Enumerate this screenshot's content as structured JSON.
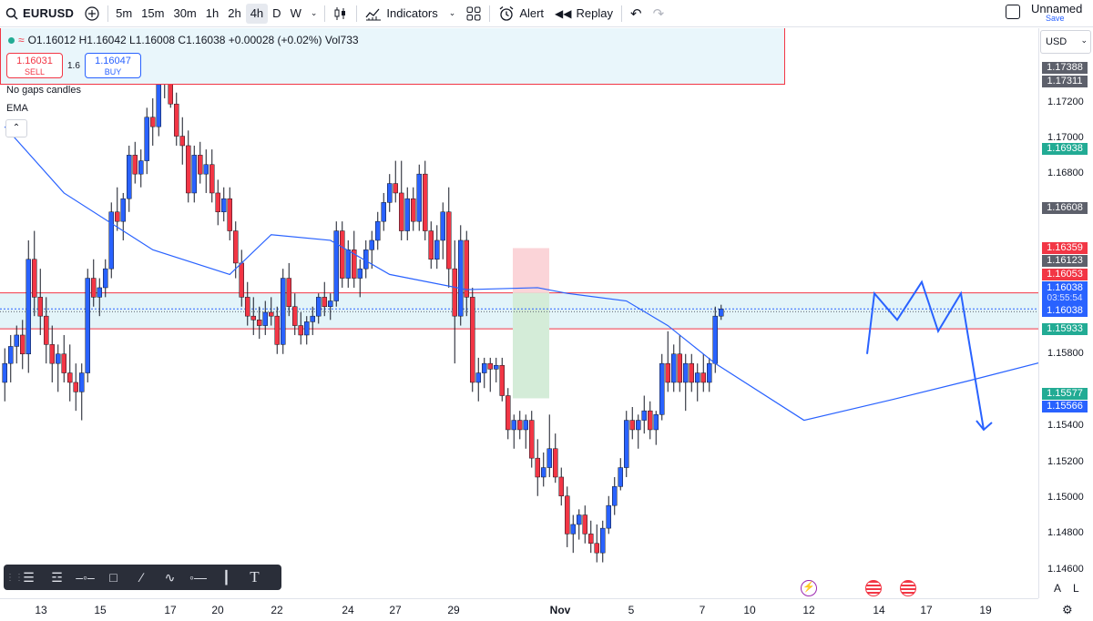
{
  "toolbar": {
    "symbol": "EURUSD",
    "timeframes": [
      "5m",
      "15m",
      "30m",
      "1h",
      "2h",
      "4h",
      "D",
      "W"
    ],
    "active_timeframe": "4h",
    "indicators_label": "Indicators",
    "alert_label": "Alert",
    "replay_label": "Replay",
    "layout_name": "Unnamed",
    "save_label": "Save"
  },
  "legend": {
    "ohlc": "O1.16012 H1.16042 L1.16008 C1.16038 +0.00028 (+0.02%) Vol733",
    "sell_price": "1.16031",
    "sell_label": "SELL",
    "spread": "1.6",
    "buy_price": "1.16047",
    "buy_label": "BUY",
    "indicator_1": "No gaps candles",
    "indicator_2": "EMA",
    "collapse_icon": "chevron-up-icon"
  },
  "price_axis": {
    "currency": "USD",
    "ticks": [
      "1.17200",
      "1.17000",
      "1.16800",
      "1.15800",
      "1.15400",
      "1.15200",
      "1.15000",
      "1.14800",
      "1.14600"
    ],
    "tags": [
      {
        "text": "1.17388",
        "color": "#5d606b"
      },
      {
        "text": "1.17311",
        "color": "#5d606b"
      },
      {
        "text": "1.16938",
        "color": "#22ab94"
      },
      {
        "text": "1.16608",
        "color": "#5d606b"
      },
      {
        "text": "1.16359",
        "color": "#f23645"
      },
      {
        "text": "1.16123",
        "color": "#5d606b"
      },
      {
        "text": "1.16053",
        "color": "#f23645"
      },
      {
        "text": "1.16038",
        "color": "#2962ff"
      },
      {
        "text": "03:55:54",
        "color": "#2962ff"
      },
      {
        "text": "1.16038",
        "color": "#2962ff"
      },
      {
        "text": "1.15933",
        "color": "#22ab94"
      },
      {
        "text": "1.15577",
        "color": "#22ab94"
      },
      {
        "text": "1.15566",
        "color": "#2962ff"
      }
    ]
  },
  "time_axis": {
    "ticks": [
      "13",
      "15",
      "17",
      "20",
      "22",
      "24",
      "27",
      "29",
      "Nov",
      "5",
      "7",
      "10",
      "12",
      "14",
      "17",
      "19"
    ]
  },
  "bottom_right": {
    "auto_label": "A",
    "log_label": "L"
  },
  "colors": {
    "up": "#2962ff",
    "down": "#f23645",
    "ema": "#2962ff",
    "zone": "#e3f4f9",
    "stop": "#fbd4d8",
    "target": "#d4ecd8"
  },
  "chart_data": {
    "type": "candlestick",
    "instrument": "EURUSD",
    "interval": "4h",
    "ylim": [
      1.1452,
      1.1752
    ],
    "zone": [
      1.15933,
      1.16123
    ],
    "candles": [
      [
        1.1565,
        1.1583,
        1.1555,
        1.1575
      ],
      [
        1.1575,
        1.159,
        1.1565,
        1.1584
      ],
      [
        1.1584,
        1.1595,
        1.1575,
        1.159
      ],
      [
        1.159,
        1.1598,
        1.1572,
        1.158
      ],
      [
        1.158,
        1.164,
        1.157,
        1.163
      ],
      [
        1.163,
        1.1645,
        1.16,
        1.161
      ],
      [
        1.161,
        1.1625,
        1.159,
        1.16
      ],
      [
        1.16,
        1.161,
        1.1575,
        1.1585
      ],
      [
        1.1585,
        1.1595,
        1.1565,
        1.1575
      ],
      [
        1.1575,
        1.1585,
        1.156,
        1.158
      ],
      [
        1.158,
        1.159,
        1.1565,
        1.157
      ],
      [
        1.157,
        1.1585,
        1.1555,
        1.1565
      ],
      [
        1.1565,
        1.1575,
        1.155,
        1.156
      ],
      [
        1.156,
        1.1575,
        1.1545,
        1.157
      ],
      [
        1.157,
        1.1625,
        1.1565,
        1.162
      ],
      [
        1.162,
        1.163,
        1.1605,
        1.161
      ],
      [
        1.161,
        1.162,
        1.16,
        1.1615
      ],
      [
        1.1615,
        1.163,
        1.161,
        1.1625
      ],
      [
        1.1625,
        1.166,
        1.162,
        1.1655
      ],
      [
        1.1655,
        1.1668,
        1.1645,
        1.165
      ],
      [
        1.165,
        1.1665,
        1.164,
        1.1662
      ],
      [
        1.1662,
        1.169,
        1.1655,
        1.1685
      ],
      [
        1.1685,
        1.1692,
        1.167,
        1.1675
      ],
      [
        1.1675,
        1.1688,
        1.1668,
        1.1682
      ],
      [
        1.1682,
        1.171,
        1.1675,
        1.1705
      ],
      [
        1.1705,
        1.1715,
        1.169,
        1.17
      ],
      [
        1.17,
        1.1728,
        1.1695,
        1.1725
      ],
      [
        1.1725,
        1.174,
        1.1715,
        1.173
      ],
      [
        1.173,
        1.1748,
        1.171,
        1.1712
      ],
      [
        1.1712,
        1.1718,
        1.169,
        1.1695
      ],
      [
        1.1695,
        1.1705,
        1.168,
        1.169
      ],
      [
        1.169,
        1.1698,
        1.166,
        1.1665
      ],
      [
        1.1665,
        1.169,
        1.166,
        1.1685
      ],
      [
        1.1685,
        1.1692,
        1.167,
        1.1675
      ],
      [
        1.1675,
        1.1688,
        1.1665,
        1.168
      ],
      [
        1.168,
        1.1688,
        1.166,
        1.1665
      ],
      [
        1.1665,
        1.1672,
        1.1648,
        1.1655
      ],
      [
        1.1655,
        1.1668,
        1.165,
        1.1662
      ],
      [
        1.1662,
        1.1668,
        1.164,
        1.1645
      ],
      [
        1.1645,
        1.165,
        1.162,
        1.1628
      ],
      [
        1.1628,
        1.1635,
        1.1605,
        1.161
      ],
      [
        1.161,
        1.1618,
        1.1595,
        1.16
      ],
      [
        1.16,
        1.161,
        1.159,
        1.1598
      ],
      [
        1.1598,
        1.1605,
        1.1588,
        1.1595
      ],
      [
        1.1595,
        1.1608,
        1.159,
        1.1602
      ],
      [
        1.1602,
        1.161,
        1.1595,
        1.16
      ],
      [
        1.16,
        1.1605,
        1.158,
        1.1585
      ],
      [
        1.1585,
        1.1625,
        1.158,
        1.162
      ],
      [
        1.162,
        1.1628,
        1.16,
        1.1605
      ],
      [
        1.1605,
        1.1612,
        1.159,
        1.1595
      ],
      [
        1.1595,
        1.1602,
        1.1585,
        1.159
      ],
      [
        1.159,
        1.16,
        1.1585,
        1.1597
      ],
      [
        1.1597,
        1.1605,
        1.159,
        1.16
      ],
      [
        1.16,
        1.1612,
        1.1596,
        1.161
      ],
      [
        1.161,
        1.1618,
        1.16,
        1.1605
      ],
      [
        1.1605,
        1.1612,
        1.1598,
        1.1608
      ],
      [
        1.1608,
        1.165,
        1.1605,
        1.1645
      ],
      [
        1.1645,
        1.165,
        1.1615,
        1.162
      ],
      [
        1.162,
        1.164,
        1.1615,
        1.1635
      ],
      [
        1.1635,
        1.1645,
        1.1615,
        1.162
      ],
      [
        1.162,
        1.163,
        1.161,
        1.1625
      ],
      [
        1.1625,
        1.164,
        1.162,
        1.1635
      ],
      [
        1.1635,
        1.1645,
        1.1625,
        1.164
      ],
      [
        1.164,
        1.1655,
        1.1635,
        1.165
      ],
      [
        1.165,
        1.1665,
        1.1645,
        1.166
      ],
      [
        1.166,
        1.1675,
        1.1655,
        1.167
      ],
      [
        1.167,
        1.1682,
        1.166,
        1.1665
      ],
      [
        1.1665,
        1.1682,
        1.164,
        1.1645
      ],
      [
        1.1645,
        1.1668,
        1.164,
        1.1662
      ],
      [
        1.1662,
        1.1668,
        1.1645,
        1.165
      ],
      [
        1.165,
        1.168,
        1.1645,
        1.1675
      ],
      [
        1.1675,
        1.1682,
        1.164,
        1.1645
      ],
      [
        1.1645,
        1.165,
        1.1625,
        1.163
      ],
      [
        1.163,
        1.1648,
        1.1625,
        1.164
      ],
      [
        1.164,
        1.166,
        1.163,
        1.1655
      ],
      [
        1.1655,
        1.1668,
        1.1615,
        1.1625
      ],
      [
        1.1625,
        1.164,
        1.1575,
        1.16
      ],
      [
        1.16,
        1.1648,
        1.1595,
        1.164
      ],
      [
        1.164,
        1.1645,
        1.16,
        1.161
      ],
      [
        1.161,
        1.1615,
        1.156,
        1.1565
      ],
      [
        1.1565,
        1.1578,
        1.1555,
        1.157
      ],
      [
        1.157,
        1.1578,
        1.1562,
        1.1575
      ],
      [
        1.1575,
        1.1578,
        1.156,
        1.1572
      ],
      [
        1.1572,
        1.1578,
        1.1565,
        1.1574
      ],
      [
        1.1574,
        1.1578,
        1.1555,
        1.1558
      ],
      [
        1.1558,
        1.1562,
        1.1535,
        1.154
      ],
      [
        1.154,
        1.1548,
        1.153,
        1.1545
      ],
      [
        1.1545,
        1.155,
        1.1535,
        1.154
      ],
      [
        1.154,
        1.1548,
        1.153,
        1.1545
      ],
      [
        1.1545,
        1.155,
        1.152,
        1.1525
      ],
      [
        1.1525,
        1.1535,
        1.1505,
        1.1515
      ],
      [
        1.1515,
        1.1528,
        1.151,
        1.152
      ],
      [
        1.152,
        1.1548,
        1.1515,
        1.153
      ],
      [
        1.153,
        1.1538,
        1.1512,
        1.1515
      ],
      [
        1.1515,
        1.152,
        1.15,
        1.1505
      ],
      [
        1.1505,
        1.151,
        1.1478,
        1.1485
      ],
      [
        1.1485,
        1.1495,
        1.1475,
        1.149
      ],
      [
        1.149,
        1.1498,
        1.1482,
        1.1495
      ],
      [
        1.1495,
        1.15,
        1.148,
        1.1485
      ],
      [
        1.1485,
        1.1492,
        1.1475,
        1.148
      ],
      [
        1.148,
        1.149,
        1.147,
        1.1475
      ],
      [
        1.1475,
        1.1492,
        1.147,
        1.1488
      ],
      [
        1.1488,
        1.1505,
        1.1485,
        1.15
      ],
      [
        1.15,
        1.1515,
        1.1495,
        1.151
      ],
      [
        1.151,
        1.1525,
        1.1508,
        1.152
      ],
      [
        1.152,
        1.155,
        1.1515,
        1.1545
      ],
      [
        1.1545,
        1.1552,
        1.1535,
        1.154
      ],
      [
        1.154,
        1.1548,
        1.153,
        1.1545
      ],
      [
        1.1545,
        1.1558,
        1.1538,
        1.155
      ],
      [
        1.155,
        1.1555,
        1.1535,
        1.154
      ],
      [
        1.154,
        1.155,
        1.1532,
        1.1548
      ],
      [
        1.1548,
        1.158,
        1.1545,
        1.1575
      ],
      [
        1.1575,
        1.1592,
        1.156,
        1.1565
      ],
      [
        1.1565,
        1.1585,
        1.156,
        1.158
      ],
      [
        1.158,
        1.159,
        1.156,
        1.1565
      ],
      [
        1.1565,
        1.158,
        1.155,
        1.1575
      ],
      [
        1.1575,
        1.158,
        1.156,
        1.1565
      ],
      [
        1.1565,
        1.1575,
        1.1555,
        1.157
      ],
      [
        1.157,
        1.158,
        1.156,
        1.1565
      ],
      [
        1.1565,
        1.1578,
        1.156,
        1.1575
      ],
      [
        1.1575,
        1.1605,
        1.157,
        1.16
      ],
      [
        1.16,
        1.1606,
        1.1598,
        1.16038
      ]
    ],
    "ema": [
      [
        0,
        1.17
      ],
      [
        10,
        1.1665
      ],
      [
        25,
        1.1635
      ],
      [
        38,
        1.1622
      ],
      [
        45,
        1.1643
      ],
      [
        55,
        1.164
      ],
      [
        65,
        1.1622
      ],
      [
        78,
        1.1614
      ],
      [
        90,
        1.1615
      ],
      [
        95,
        1.1612
      ],
      [
        105,
        1.1608
      ],
      [
        112,
        1.1595
      ],
      [
        120,
        1.1575
      ],
      [
        135,
        1.1545
      ],
      [
        150,
        1.1556
      ],
      [
        163,
        1.1566
      ],
      [
        178,
        1.1578
      ]
    ],
    "position": {
      "entry": 1.16123,
      "stop": 1.16359,
      "target": 1.15566
    },
    "forecast": [
      1.158,
      1.1612,
      1.1598,
      1.1618,
      1.1592,
      1.1612,
      1.154
    ]
  }
}
